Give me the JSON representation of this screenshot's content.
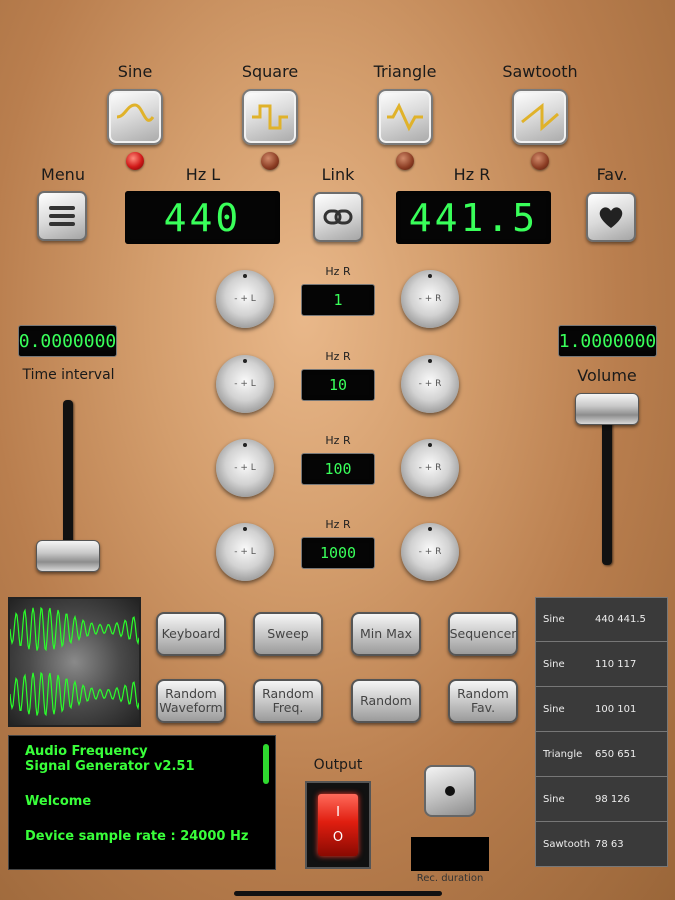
{
  "waveforms": [
    {
      "label": "Sine",
      "icon": "sine-wave-icon",
      "active": true
    },
    {
      "label": "Square",
      "icon": "square-wave-icon",
      "active": false
    },
    {
      "label": "Triangle",
      "icon": "triangle-wave-icon",
      "active": false
    },
    {
      "label": "Sawtooth",
      "icon": "sawtooth-wave-icon",
      "active": false
    }
  ],
  "menu": {
    "label": "Menu"
  },
  "link": {
    "label": "Link"
  },
  "fav": {
    "label": "Fav."
  },
  "left_channel": {
    "label": "Hz L",
    "value": "440"
  },
  "right_channel": {
    "label": "Hz R",
    "value": "441.5"
  },
  "step_rows": [
    {
      "label": "Hz R",
      "value": "1",
      "knob_left": "- + L",
      "knob_right": "- + R"
    },
    {
      "label": "Hz R",
      "value": "10",
      "knob_left": "- + L",
      "knob_right": "- + R"
    },
    {
      "label": "Hz R",
      "value": "100",
      "knob_left": "- + L",
      "knob_right": "- + R"
    },
    {
      "label": "Hz R",
      "value": "1000",
      "knob_left": "- + L",
      "knob_right": "- + R"
    }
  ],
  "time_interval": {
    "label": "Time interval",
    "value": "0.0000000",
    "level": 0.0
  },
  "volume": {
    "label": "Volume",
    "value": "1.0000000",
    "level": 1.0
  },
  "functions": [
    {
      "label": "Keyboard"
    },
    {
      "label": "Sweep"
    },
    {
      "label": "Min Max"
    },
    {
      "label": "Sequencer"
    },
    {
      "label": "Random Waveform"
    },
    {
      "label": "Random Freq."
    },
    {
      "label": "Random"
    },
    {
      "label": "Random Fav."
    }
  ],
  "messages": {
    "line1": "Audio Frequency",
    "line2": "Signal Generator v2.51",
    "line3": "Welcome",
    "line4": "Device sample rate : 24000 Hz"
  },
  "output": {
    "label": "Output",
    "on_symbol": "I",
    "off_symbol": "O"
  },
  "recording": {
    "label": "Rec. duration",
    "value": ""
  },
  "favorites": [
    {
      "wave": "Sine",
      "freqs": "440 441.5"
    },
    {
      "wave": "Sine",
      "freqs": "110 117"
    },
    {
      "wave": "Sine",
      "freqs": "100 101"
    },
    {
      "wave": "Triangle",
      "freqs": "650 651"
    },
    {
      "wave": "Sine",
      "freqs": "98 126"
    },
    {
      "wave": "Sawtooth",
      "freqs": "78 63"
    }
  ],
  "colors": {
    "lcd_text": "#39ff5a",
    "led_on": "#d01818",
    "copper": "#c48a58"
  }
}
